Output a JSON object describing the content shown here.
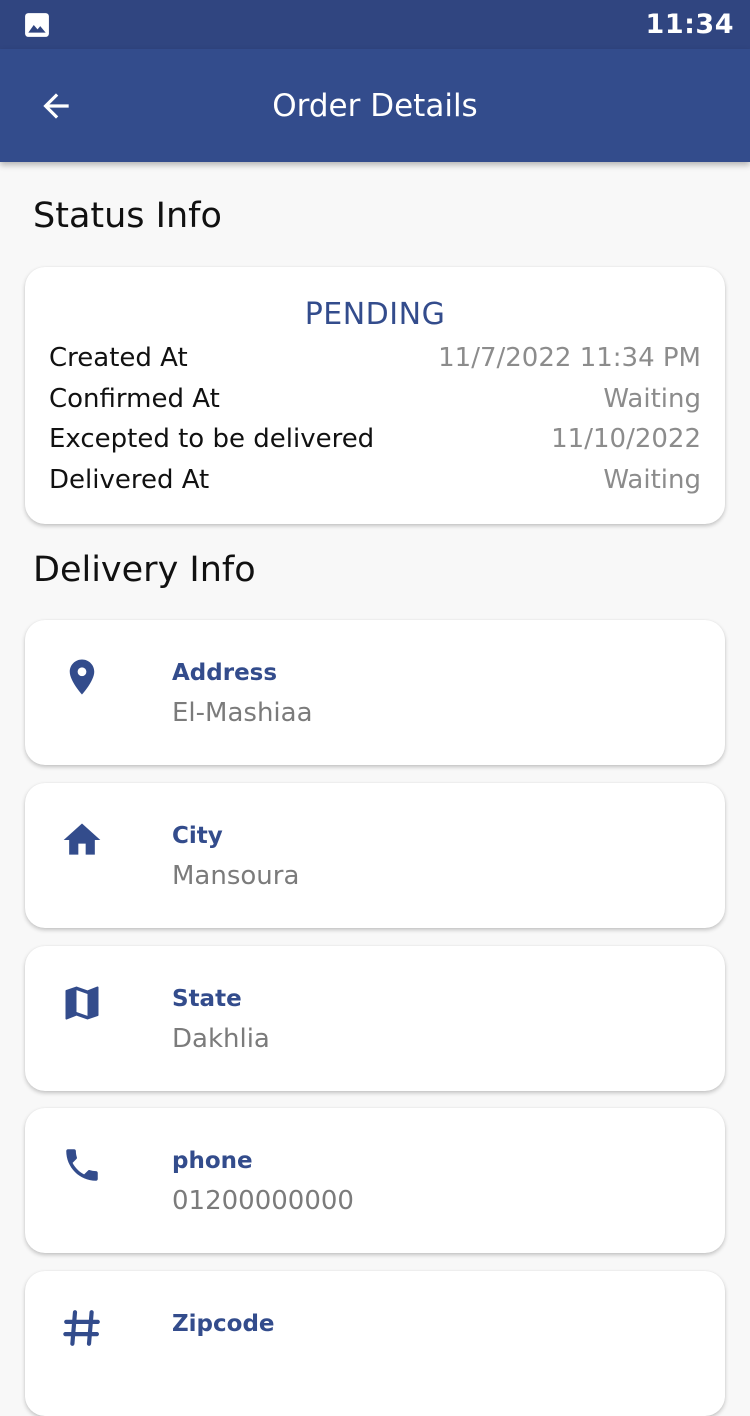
{
  "status_bar": {
    "time": "11:34",
    "left_icon": "image-icon"
  },
  "app_bar": {
    "title": "Order Details",
    "back_icon": "arrow-back-icon"
  },
  "status_info": {
    "heading": "Status Info",
    "status": "PENDING",
    "rows": [
      {
        "label": "Created At",
        "value": "11/7/2022 11:34 PM"
      },
      {
        "label": "Confirmed At",
        "value": "Waiting"
      },
      {
        "label": "Excepted to be delivered",
        "value": "11/10/2022"
      },
      {
        "label": "Delivered At",
        "value": "Waiting"
      }
    ]
  },
  "delivery_info": {
    "heading": "Delivery Info",
    "items": [
      {
        "icon": "location-pin-icon",
        "label": "Address",
        "value": "El-Mashiaa"
      },
      {
        "icon": "home-icon",
        "label": "City",
        "value": "Mansoura"
      },
      {
        "icon": "map-icon",
        "label": "State",
        "value": "Dakhlia"
      },
      {
        "icon": "phone-icon",
        "label": "phone",
        "value": "01200000000"
      },
      {
        "icon": "hash-icon",
        "label": "Zipcode",
        "value": ""
      }
    ]
  },
  "colors": {
    "status_bar": "#304580",
    "app_bar": "#334c8c",
    "accent": "#334c8c",
    "background": "#f8f8f8",
    "muted_text": "#8c8c8c"
  }
}
